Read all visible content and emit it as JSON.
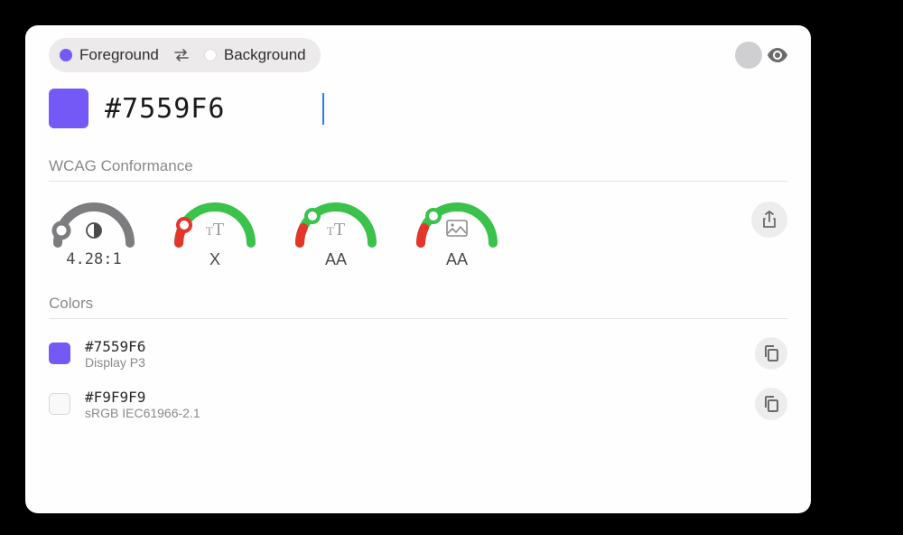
{
  "segmented": {
    "foreground_label": "Foreground",
    "background_label": "Background"
  },
  "current_color": {
    "hex": "#7559F6"
  },
  "wcag": {
    "section_title": "WCAG Conformance",
    "contrast_ratio": "4.28:1",
    "normal_text": "X",
    "large_text": "AA",
    "graphical": "AA"
  },
  "colors_section": {
    "title": "Colors",
    "items": [
      {
        "hex": "#7559F6",
        "profile": "Display P3",
        "swatch": "#7559F6"
      },
      {
        "hex": "#F9F9F9",
        "profile": "sRGB IEC61966-2.1",
        "swatch": "#F9F9F9"
      }
    ]
  }
}
